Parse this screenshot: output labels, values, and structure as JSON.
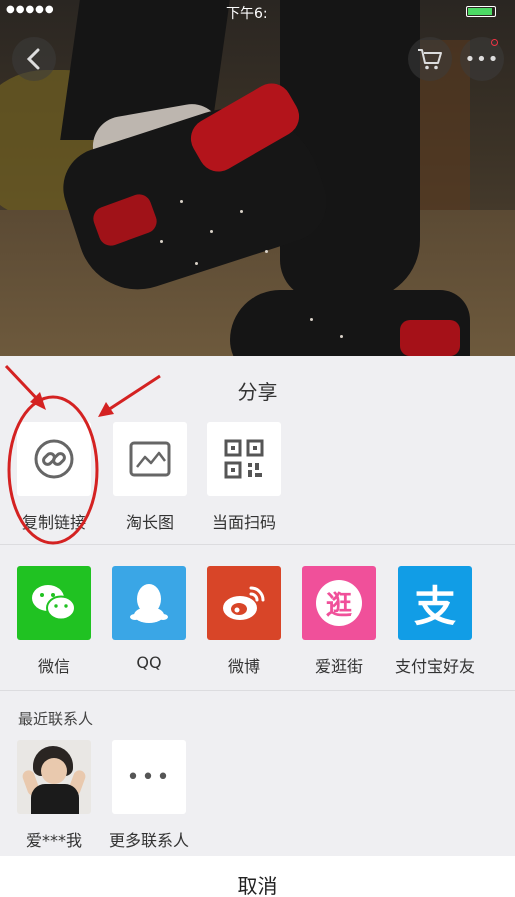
{
  "status_bar": {
    "carrier_dots": "●●●●●",
    "time": "下午6:"
  },
  "sheet": {
    "title": "分享",
    "row1": [
      {
        "label": "复制链接",
        "icon": "link-icon"
      },
      {
        "label": "淘长图",
        "icon": "long-image-icon"
      },
      {
        "label": "当面扫码",
        "icon": "qrcode-icon"
      }
    ],
    "row2": [
      {
        "label": "微信",
        "icon": "wechat-icon",
        "color": "#20c222"
      },
      {
        "label": "QQ",
        "icon": "qq-icon",
        "color": "#3aa6e6"
      },
      {
        "label": "微博",
        "icon": "weibo-icon",
        "color": "#d84528"
      },
      {
        "label": "爱逛街",
        "icon": "aiguangjie-icon",
        "color": "#f0509a",
        "glyph": "逛"
      },
      {
        "label": "支付宝好友",
        "icon": "alipay-icon",
        "color": "#119de6",
        "glyph": "支"
      }
    ],
    "recent_label": "最近联系人",
    "contacts": [
      {
        "label": "爱***我",
        "icon": "avatar"
      },
      {
        "label": "更多联系人",
        "icon": "more-dots-icon",
        "glyph": "•••"
      }
    ],
    "cancel_label": "取消"
  },
  "colors": {
    "annotation": "#d42222",
    "sheet_bg": "#efeff2"
  }
}
